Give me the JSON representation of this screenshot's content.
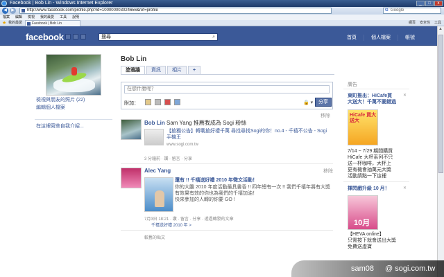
{
  "browser": {
    "title": "Facebook | Bob Lin - Windows Internet Explorer",
    "url": "http://www.facebook.com/profile.php?id=100000003024656&ref=profile",
    "search_placeholder": "Google",
    "menu": [
      "檔案",
      "編輯",
      "檢視",
      "我的最愛",
      "工具",
      "說明"
    ],
    "favorites_label": "我的最愛",
    "tab_label": "Facebook | Bob Lin",
    "tools": [
      "網頁",
      "安全性",
      "工具"
    ],
    "window_buttons": [
      "_",
      "□",
      "x"
    ]
  },
  "fb": {
    "logo": "facebook",
    "search_value": "搜尋",
    "nav": [
      "首頁",
      "個人檔案",
      "帳號"
    ]
  },
  "profile": {
    "name": "Bob Lin",
    "tabs": [
      "塗鴉牆",
      "資訊",
      "相片",
      "+"
    ],
    "left_links": [
      "檢視與朋友的照片 (22)",
      "編輯個人檔案",
      "在這裡寫些自我介紹..."
    ]
  },
  "composer": {
    "placeholder": "在想什麼呢？",
    "attach_label": "附加：",
    "lock": "🔒 ▾",
    "share_label": "分享"
  },
  "stories": [
    {
      "name": "Bob Lin",
      "action": "Sam Yang 推薦我成為 Sogi 粉絲",
      "remove": "移除",
      "link_title": "【搶獨公告】轉載搶好禮千萬 尋找尋找Sogi的你！no.4 - 千禧不公告 - Sogi 手機王",
      "link_url": "www.sogi.com.tw",
      "meta": "3 分鐘前 · 讚 · 留言 · 分享"
    },
    {
      "name": "Alec Yang",
      "remove": "移除",
      "line1": "還有 !! 千禧送好禮 2010 年徵文活動！",
      "line2": "你的大膽 2010 年度活動最具書香 !! 四年總有一次 !! 我們千禧年將有大獎",
      "line3": "有效果有效的你也為我們的千禧加油！",
      "line4": "快來參加的人轉的你要 GO !",
      "meta": "7月3日 18:21 · 讚 · 留言 · 分享 · 透過轉發的文章",
      "meta2": "千禧送好禮 2010 年 >"
    }
  ],
  "older_posts": "較舊的貼文",
  "ads": {
    "section_title": "廣告",
    "ad1_title": "東町推出：HiCafe買",
    "ad1_title2": "大送大！千萬不要錯過",
    "ad1_img_text": "HiCafe 買大送大",
    "ad1_body": [
      "7/14 ~ 7/29 期間購買",
      "HiCafe 大杯系列不只",
      "送一杯咖啡，大杯上",
      "更有機會抽萬元大獎",
      "活動請點一下這裡"
    ],
    "ad2_title": "揮閃戲升級 10 月！",
    "ad2_img_text": "10月",
    "ad2_body": [
      "【HEVA online】",
      "只需按下就會送出大獎",
      "免費送虛寶"
    ]
  },
  "watermark": {
    "left": "sam08",
    "right": "@ sogi.com.tw"
  },
  "colors": {
    "fb_blue": "#3b5998",
    "link": "#3b5998",
    "share_button": "#5b74a8"
  }
}
